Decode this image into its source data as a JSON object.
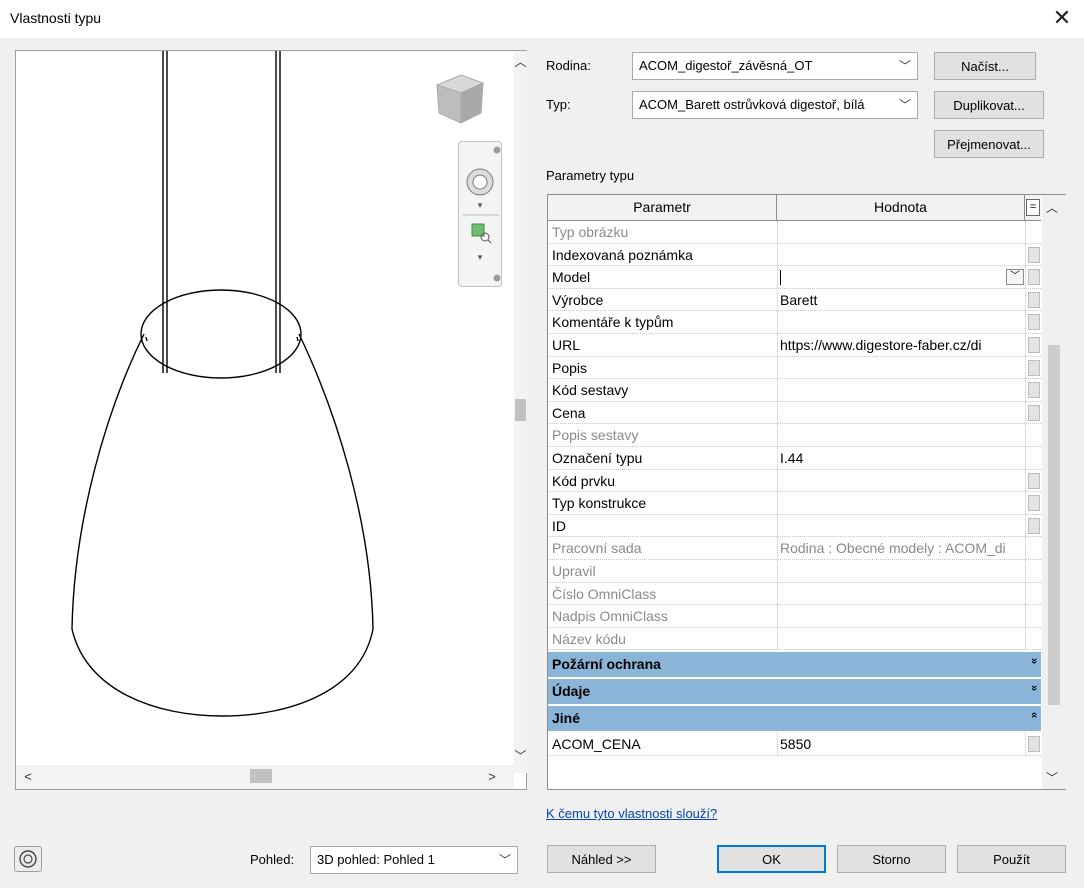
{
  "window": {
    "title": "Vlastnosti typu"
  },
  "family": {
    "label": "Rodina:",
    "value": "ACOM_digestoř_závěsná_OT"
  },
  "type": {
    "label": "Typ:",
    "value": "ACOM_Barett ostrůvková digestoř, bílá"
  },
  "buttons": {
    "load": "Načíst...",
    "duplicate": "Duplikovat...",
    "rename": "Přejmenovat...",
    "preview": "Náhled >>",
    "ok": "OK",
    "cancel": "Storno",
    "apply": "Použít"
  },
  "section_label": "Parametry typu",
  "table": {
    "header_param": "Parametr",
    "header_value": "Hodnota",
    "header_extra": "=",
    "rows": [
      {
        "param": "Typ obrázku",
        "value": "",
        "grey": true
      },
      {
        "param": "Indexovaná poznámka",
        "value": ""
      },
      {
        "param": "Model",
        "value": ""
      },
      {
        "param": "Výrobce",
        "value": "Barett"
      },
      {
        "param": "Komentáře k typům",
        "value": ""
      },
      {
        "param": "URL",
        "value": "https://www.digestore-faber.cz/di"
      },
      {
        "param": "Popis",
        "value": ""
      },
      {
        "param": "Kód sestavy",
        "value": ""
      },
      {
        "param": "Cena",
        "value": ""
      },
      {
        "param": "Popis sestavy",
        "value": "",
        "grey": true
      },
      {
        "param": "Označení typu",
        "value": "I.44"
      },
      {
        "param": "Kód prvku",
        "value": ""
      },
      {
        "param": "Typ konstrukce",
        "value": ""
      },
      {
        "param": "ID",
        "value": ""
      },
      {
        "param": "Pracovní sada",
        "value": "Rodina  : Obecné modely : ACOM_di",
        "grey": true
      },
      {
        "param": "Upravil",
        "value": "",
        "grey": true
      },
      {
        "param": "Číslo OmniClass",
        "value": "",
        "grey": true
      },
      {
        "param": "Nadpis OmniClass",
        "value": "",
        "grey": true
      },
      {
        "param": "Název kódu",
        "value": "",
        "grey": true
      }
    ],
    "groups": [
      {
        "label": "Požární ochrana",
        "icon": "»"
      },
      {
        "label": "Údaje",
        "icon": "»"
      },
      {
        "label": "Jiné",
        "icon": "«"
      }
    ],
    "other_rows": [
      {
        "param": "ACOM_CENA",
        "value": "5850"
      }
    ]
  },
  "help_link": "K čemu tyto vlastnosti slouží?",
  "view": {
    "label": "Pohled:",
    "value": "3D pohled: Pohled 1"
  }
}
